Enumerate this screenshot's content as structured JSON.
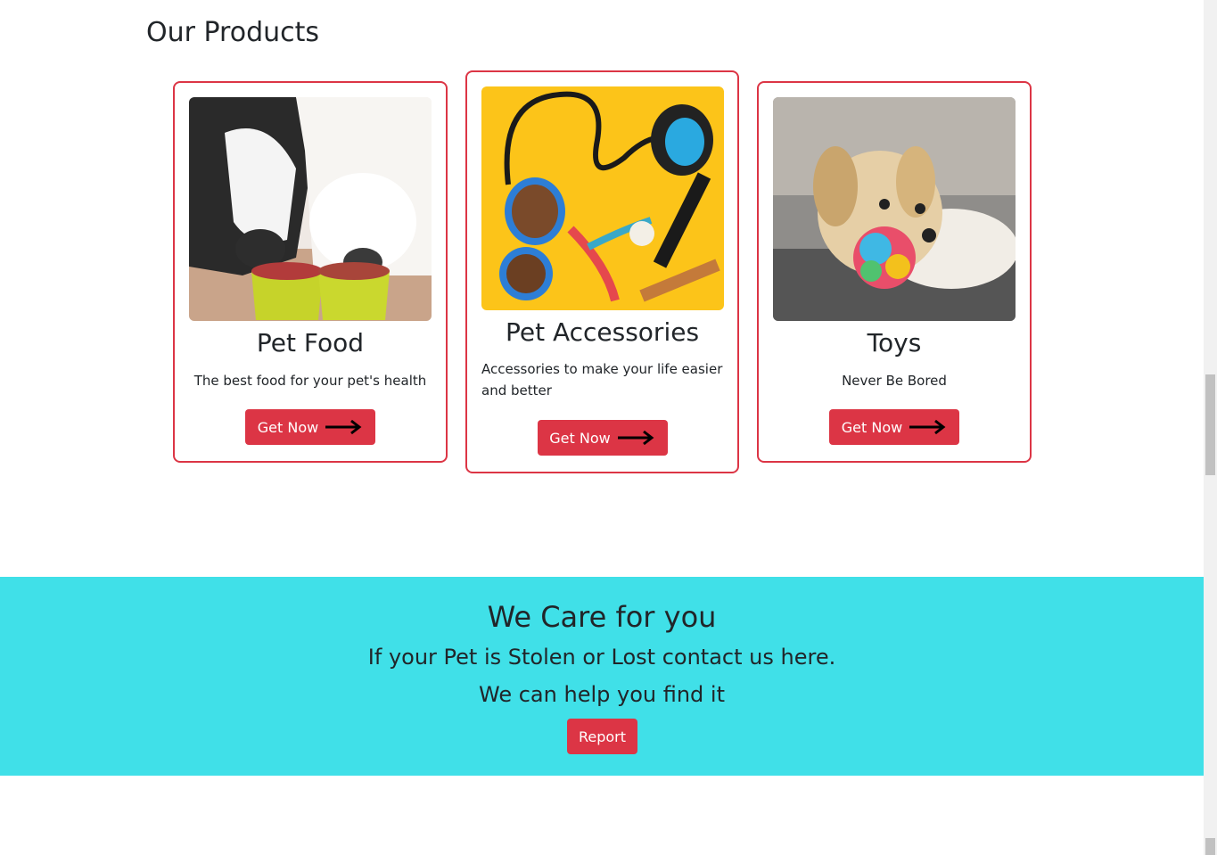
{
  "section": {
    "title": "Our Products"
  },
  "products": [
    {
      "title": "Pet Food",
      "text": "The best food for your pet's health",
      "button": "Get Now",
      "image": "cat-and-dog-eating-photo"
    },
    {
      "title": "Pet Accessories",
      "text": "Accessories to make your life easier and better",
      "button": "Get Now",
      "image": "leash-bowl-toys-photo"
    },
    {
      "title": "Toys",
      "text": "Never Be Bored",
      "button": "Get Now",
      "image": "puppy-with-toy-ball-photo"
    }
  ],
  "care": {
    "title": "We Care for you",
    "line1": "If your Pet is Stolen or Lost contact us here.",
    "line2": "We can help you find it",
    "button": "Report"
  },
  "colors": {
    "accent": "#dc3545",
    "banner": "#40e0e8",
    "text": "#212529"
  }
}
